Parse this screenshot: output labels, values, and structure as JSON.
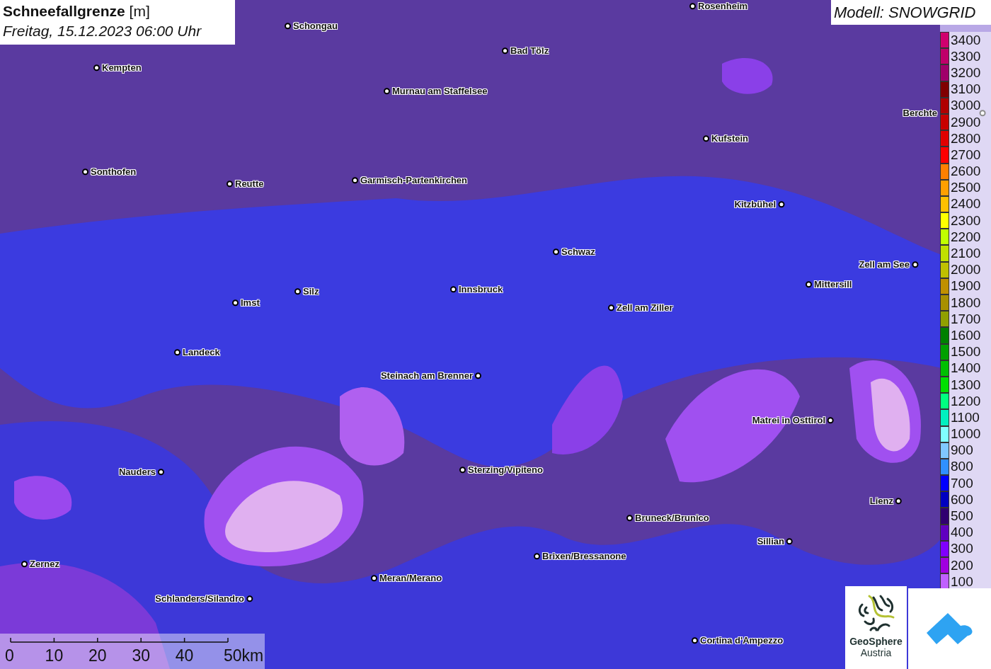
{
  "title": {
    "heading": "**Schneefallgrenze** [m]",
    "datetime": "Freitag, 15.12.2023 06:00 Uhr"
  },
  "model": "Modell: SNOWGRID",
  "map": {
    "kind": "picture",
    "cities": [
      {
        "name": "Rosenheim"
      },
      {
        "name": "Schongau"
      },
      {
        "name": "Bad Tölz"
      },
      {
        "name": "Kempten"
      },
      {
        "name": "Murnau am Staffelsee"
      },
      {
        "name": "Berchte"
      },
      {
        "name": "Kufstein"
      },
      {
        "name": "Sonthofen"
      },
      {
        "name": "Reutte"
      },
      {
        "name": "Garmisch-Partenkirchen"
      },
      {
        "name": "Kitzbühel"
      },
      {
        "name": "Schwaz"
      },
      {
        "name": "Zell am See"
      },
      {
        "name": "Mittersill"
      },
      {
        "name": "Innsbruck"
      },
      {
        "name": "Silz"
      },
      {
        "name": "Imst"
      },
      {
        "name": "Zell am Ziller"
      },
      {
        "name": "Landeck"
      },
      {
        "name": "Steinach am Brenner"
      },
      {
        "name": "Matrei in Osttirol"
      },
      {
        "name": "Nauders"
      },
      {
        "name": "Sterzing/Vipiteno"
      },
      {
        "name": "Lienz"
      },
      {
        "name": "Bruneck/Brunico"
      },
      {
        "name": "Sillian"
      },
      {
        "name": "Brixen/Bressanone"
      },
      {
        "name": "Zernez"
      },
      {
        "name": "Meran/Merano"
      },
      {
        "name": "Schlanders/Silandro"
      },
      {
        "name": "Cortina d'Ampezzo"
      }
    ]
  },
  "legend": [
    {
      "label": "3400",
      "color": "#d0006e"
    },
    {
      "label": "3300",
      "color": "#c0006a"
    },
    {
      "label": "3200",
      "color": "#a0006a"
    },
    {
      "label": "3100",
      "color": "#800000"
    },
    {
      "label": "3000",
      "color": "#b00000"
    },
    {
      "label": "2900",
      "color": "#c80000"
    },
    {
      "label": "2800",
      "color": "#e00000"
    },
    {
      "label": "2700",
      "color": "#ff0000"
    },
    {
      "label": "2600",
      "color": "#ff8000"
    },
    {
      "label": "2500",
      "color": "#ffa000"
    },
    {
      "label": "2400",
      "color": "#ffc000"
    },
    {
      "label": "2300",
      "color": "#ffff00"
    },
    {
      "label": "2200",
      "color": "#c0ff00"
    },
    {
      "label": "2100",
      "color": "#c0e000"
    },
    {
      "label": "2000",
      "color": "#c0c000"
    },
    {
      "label": "1900",
      "color": "#c09000"
    },
    {
      "label": "1800",
      "color": "#a89000"
    },
    {
      "label": "1700",
      "color": "#90a000"
    },
    {
      "label": "1600",
      "color": "#008000"
    },
    {
      "label": "1500",
      "color": "#00a000"
    },
    {
      "label": "1400",
      "color": "#00c000"
    },
    {
      "label": "1300",
      "color": "#00e000"
    },
    {
      "label": "1200",
      "color": "#00ff80"
    },
    {
      "label": "1100",
      "color": "#00f0c0"
    },
    {
      "label": "1000",
      "color": "#80ffff"
    },
    {
      "label": "900",
      "color": "#80c8ff"
    },
    {
      "label": "800",
      "color": "#3090ff"
    },
    {
      "label": "700",
      "color": "#0000ff"
    },
    {
      "label": "600",
      "color": "#0000c0"
    },
    {
      "label": "500",
      "color": "#300070"
    },
    {
      "label": "400",
      "color": "#6000c0"
    },
    {
      "label": "300",
      "color": "#8000ff"
    },
    {
      "label": "200",
      "color": "#a000e0"
    },
    {
      "label": "100",
      "color": "#c060ff"
    }
  ],
  "scale_bar": {
    "ticks": [
      "0",
      "10",
      "20",
      "30",
      "40",
      "50km"
    ]
  },
  "logos": [
    {
      "kind": "geosphere",
      "text": "GeoSphere",
      "subtext": "Austria"
    },
    {
      "kind": "chevron"
    }
  ]
}
